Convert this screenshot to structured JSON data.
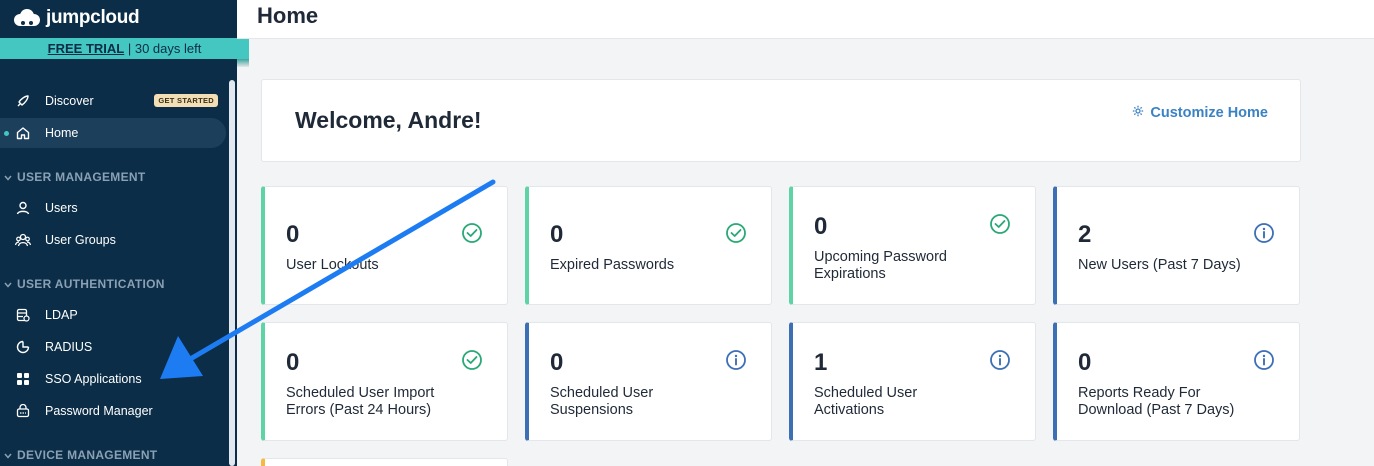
{
  "app": {
    "name": "jumpcloud"
  },
  "trial": {
    "link": "FREE TRIAL",
    "rest": " | 30 days left"
  },
  "sidebar": {
    "discover": {
      "label": "Discover",
      "badge": "GET STARTED"
    },
    "home": {
      "label": "Home"
    },
    "sections": [
      {
        "title": "USER MANAGEMENT",
        "items": [
          {
            "label": "Users"
          },
          {
            "label": "User Groups"
          }
        ]
      },
      {
        "title": "USER AUTHENTICATION",
        "items": [
          {
            "label": "LDAP"
          },
          {
            "label": "RADIUS"
          },
          {
            "label": "SSO Applications"
          },
          {
            "label": "Password Manager"
          }
        ]
      },
      {
        "title": "DEVICE MANAGEMENT",
        "items": []
      }
    ]
  },
  "header": {
    "title": "Home"
  },
  "welcome": {
    "text": "Welcome, Andre!",
    "customize": "Customize Home"
  },
  "cards": [
    {
      "value": "0",
      "label": "User Lockouts",
      "status": "ok",
      "color": "#5ed3a6"
    },
    {
      "value": "0",
      "label": "Expired Passwords",
      "status": "ok",
      "color": "#5ed3a6"
    },
    {
      "value": "0",
      "label": "Upcoming Password Expirations",
      "status": "ok",
      "color": "#5ed3a6"
    },
    {
      "value": "2",
      "label": "New Users (Past 7 Days)",
      "status": "info",
      "color": "#3d6fb5"
    },
    {
      "value": "0",
      "label": "Scheduled User Import Errors (Past 24 Hours)",
      "status": "ok",
      "color": "#5ed3a6"
    },
    {
      "value": "0",
      "label": "Scheduled User Suspensions",
      "status": "info",
      "color": "#3d6fb5"
    },
    {
      "value": "1",
      "label": "Scheduled User Activations",
      "status": "info",
      "color": "#3d6fb5"
    },
    {
      "value": "0",
      "label": "Reports Ready For Download (Past 7 Days)",
      "status": "info",
      "color": "#3d6fb5"
    }
  ],
  "colors": {
    "sidebar": "#0b2d47",
    "accent": "#44c7c0",
    "ok": "#2aa876",
    "info": "#3b6fb6",
    "arrow": "#1e7cf2"
  }
}
